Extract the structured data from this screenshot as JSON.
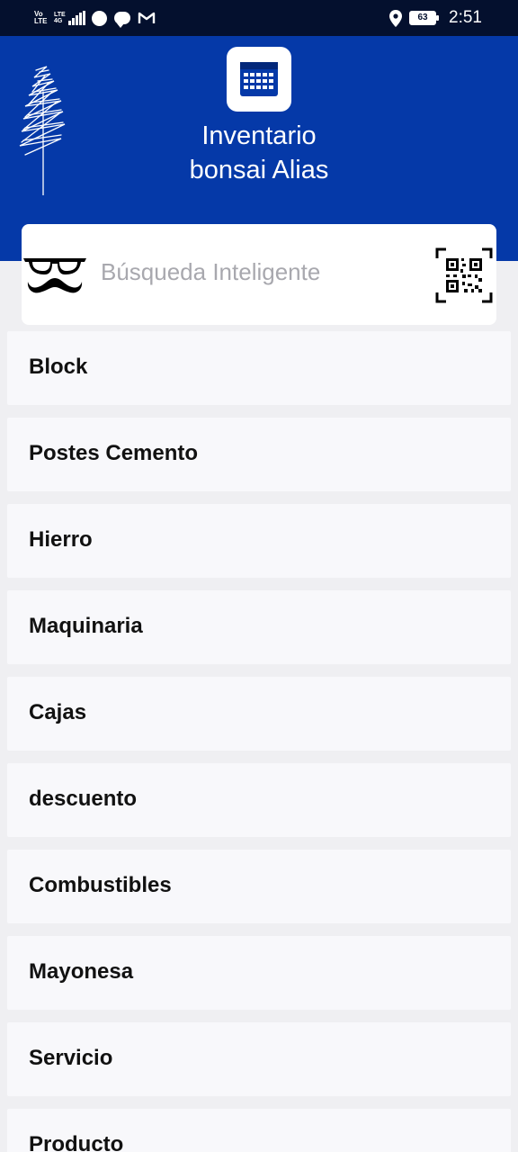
{
  "status_bar": {
    "carrier_top": "Vo",
    "carrier_bottom": "LTE",
    "network_top": "LTE",
    "network_bottom": "4G",
    "battery": "63",
    "time": "2:51"
  },
  "header": {
    "title_line1": "Inventario",
    "title_line2": "bonsai Alias",
    "background_color": "#0539a8",
    "app_icon": "calendar-icon",
    "decoration": "tree-sketch-icon"
  },
  "search": {
    "placeholder": "Búsqueda Inteligente",
    "left_icon": "glasses-mustache-icon",
    "right_icon": "qr-code-icon"
  },
  "list": {
    "items": [
      {
        "label": "Block"
      },
      {
        "label": "Postes Cemento"
      },
      {
        "label": "Hierro"
      },
      {
        "label": "Maquinaria"
      },
      {
        "label": "Cajas"
      },
      {
        "label": "descuento"
      },
      {
        "label": "Combustibles"
      },
      {
        "label": "Mayonesa"
      },
      {
        "label": "Servicio"
      },
      {
        "label": "Producto"
      }
    ]
  }
}
